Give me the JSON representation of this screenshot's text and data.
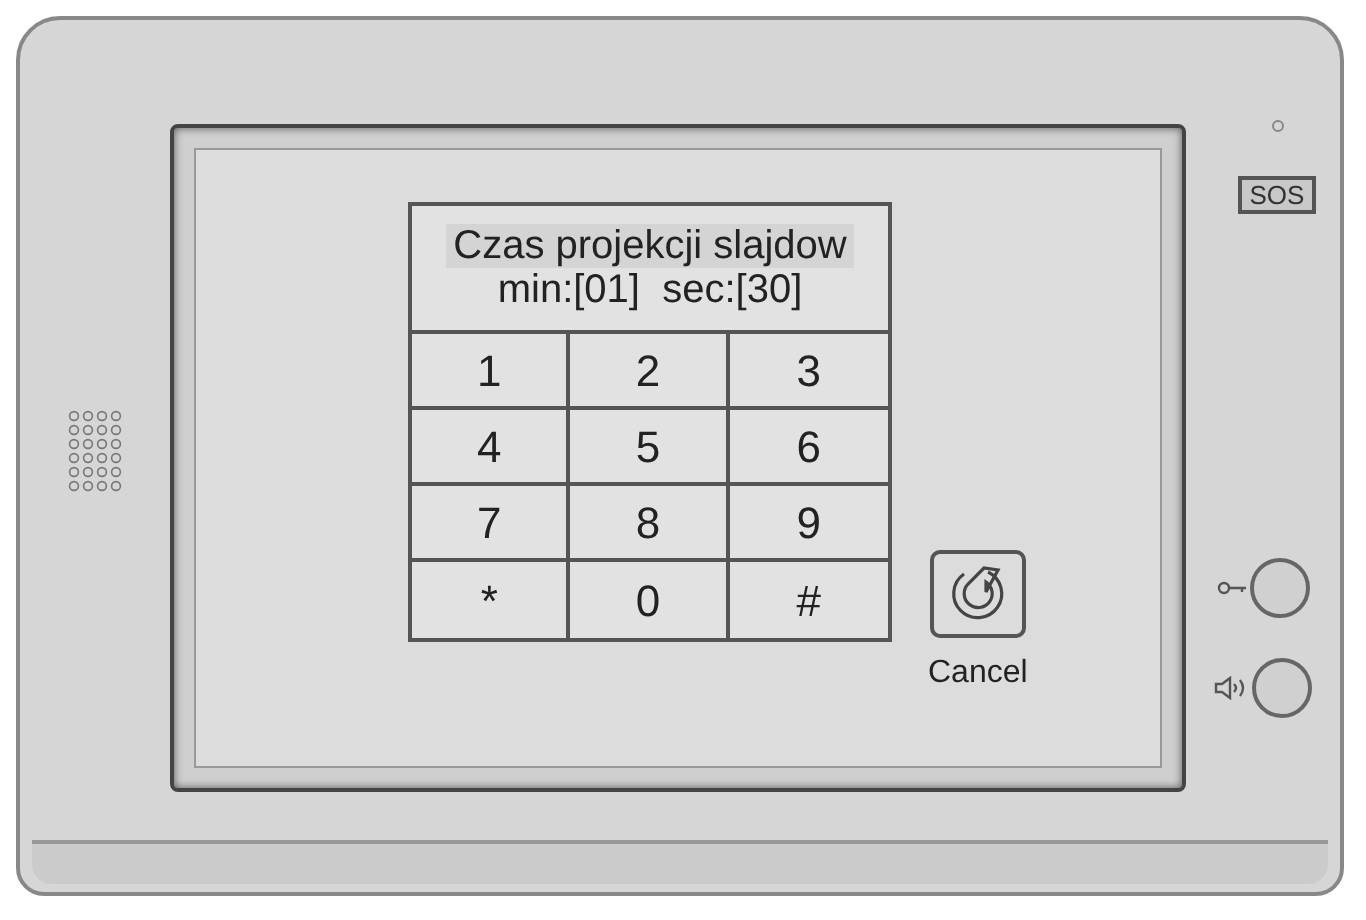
{
  "screen": {
    "title": "Czas projekcji slajdow",
    "time_line": "min:[01]  sec:[30]",
    "keypad": [
      "1",
      "2",
      "3",
      "4",
      "5",
      "6",
      "7",
      "8",
      "9",
      "*",
      "0",
      "#"
    ],
    "cancel_button": {
      "label": "Cancel"
    }
  },
  "side_panel": {
    "sos_label": "SOS"
  }
}
